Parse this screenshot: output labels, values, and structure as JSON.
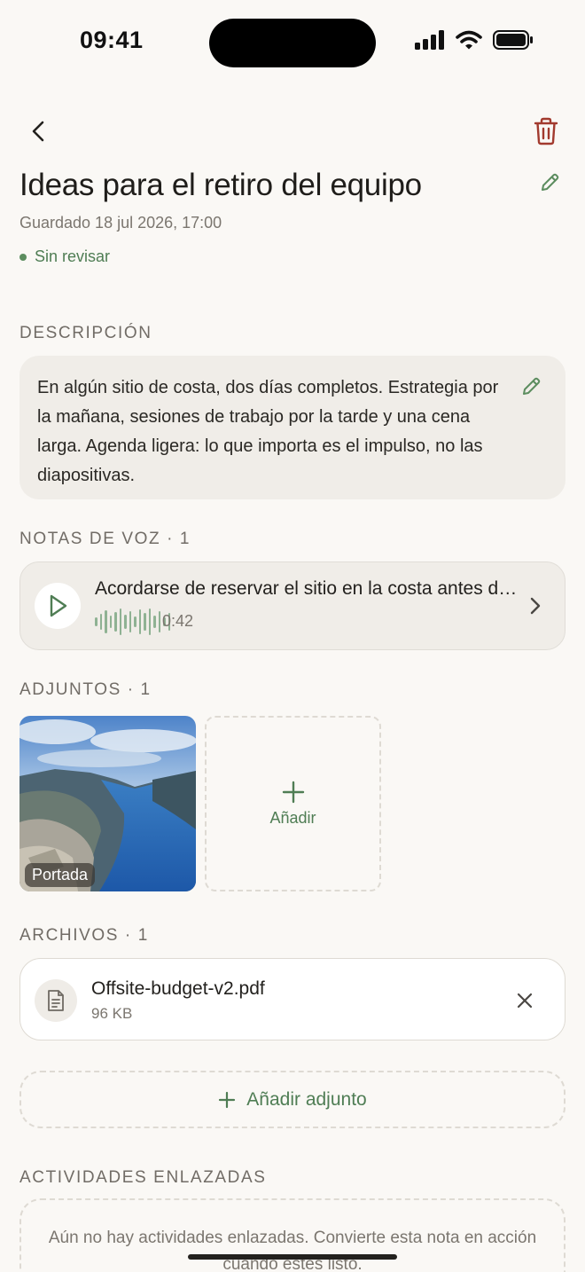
{
  "status_bar": {
    "time": "09:41"
  },
  "note": {
    "title": "Ideas para el retiro del equipo",
    "saved": "Guardado 18 jul 2026, 17:00",
    "status": "Sin revisar",
    "status_color": "#5c8d5f"
  },
  "description": {
    "label": "DESCRIPCIÓN",
    "text": "En algún sitio de costa, dos días completos. Estrategia por la mañana, sesiones de trabajo por la tarde y una cena larga. Agenda ligera: lo que importa es el impulso, no las diapositivas."
  },
  "voice_notes": {
    "label": "NOTAS DE VOZ · 1",
    "items": [
      {
        "title": "Acordarse de reservar el sitio en la costa antes de que se llene",
        "duration": "0:42"
      }
    ]
  },
  "attachments": {
    "label": "ADJUNTOS · 1",
    "cover_label": "Portada",
    "add_label": "Añadir"
  },
  "files": {
    "label": "ARCHIVOS · 1",
    "items": [
      {
        "name": "Offsite-budget-v2.pdf",
        "size": "96 KB"
      }
    ],
    "add_attachment": "Añadir adjunto"
  },
  "linked_activities": {
    "label": "ACTIVIDADES ENLAZADAS",
    "empty": "Aún no hay actividades enlazadas. Convierte esta nota en acción cuando estés listo."
  },
  "colors": {
    "accent": "#4f7d54",
    "danger": "#a23a2e",
    "background": "#faf8f5"
  },
  "icons": [
    "back-icon",
    "trash-icon",
    "pencil-icon",
    "play-icon",
    "chevron-right-icon",
    "plus-icon",
    "document-icon",
    "close-icon"
  ]
}
